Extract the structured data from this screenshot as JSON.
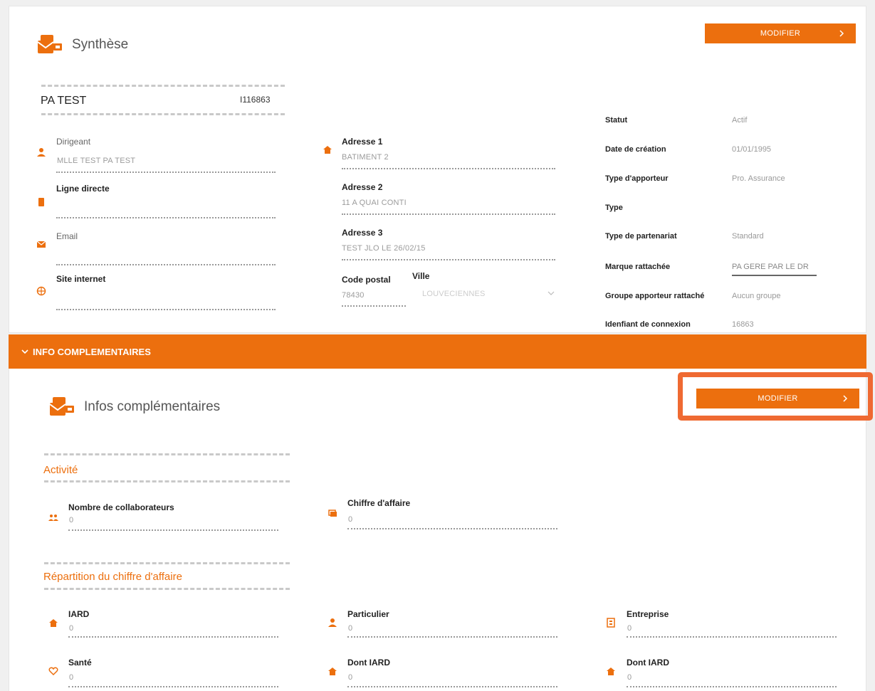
{
  "colors": {
    "accent": "#ec6f0e",
    "highlight": "#ef6a32"
  },
  "synthese": {
    "title": "Synthèse",
    "modify_label": "MODIFIER",
    "company_name": "PA TEST",
    "company_code": "I116863",
    "left_fields": [
      {
        "label": "Dirigeant",
        "value": "MLLE TEST PA TEST",
        "icon": "user-icon"
      },
      {
        "label": "Ligne directe",
        "value": "",
        "icon": "phone-icon"
      },
      {
        "label": "Email",
        "value": "",
        "icon": "mail-icon"
      },
      {
        "label": "Site internet",
        "value": "",
        "icon": "globe-icon"
      }
    ],
    "address_fields": [
      {
        "label": "Adresse 1",
        "value": "BATIMENT 2",
        "icon": "home-icon"
      },
      {
        "label": "Adresse 2",
        "value": "11 A QUAI CONTI"
      },
      {
        "label": "Adresse 3",
        "value": "TEST JLO LE 26/02/15"
      }
    ],
    "postal": {
      "label": "Code postal",
      "value": "78430"
    },
    "city": {
      "label": "Ville",
      "value": "LOUVECIENNES"
    },
    "right_fields": [
      {
        "label": "Statut",
        "value": "Actif"
      },
      {
        "label": "Date de création",
        "value": "01/01/1995"
      },
      {
        "label": "Type d'apporteur",
        "value": "Pro. Assurance"
      },
      {
        "label": "Type",
        "value": ""
      },
      {
        "label": "Type de partenariat",
        "value": "Standard"
      },
      {
        "label": "Marque rattachée",
        "value": "PA GERE PAR LE DR"
      },
      {
        "label": "Groupe apporteur rattaché",
        "value": "Aucun groupe"
      },
      {
        "label": "Idenfiant de connexion",
        "value": "16863"
      }
    ]
  },
  "accordion": {
    "label": "INFO COMPLEMENTAIRES"
  },
  "infos": {
    "title": "Infos complémentaires",
    "modify_label": "MODIFIER",
    "activite": {
      "heading": "Activité",
      "fields": [
        {
          "label": "Nombre de collaborateurs",
          "value": "0",
          "icon": "group-icon"
        },
        {
          "label": "Chiffre d'affaire",
          "value": "0",
          "icon": "money-icon"
        }
      ]
    },
    "repartition": {
      "heading": "Répartition du chiffre d'affaire",
      "fields": [
        {
          "label": "IARD",
          "value": "0",
          "icon": "home-icon"
        },
        {
          "label": "Particulier",
          "value": "0",
          "icon": "user-icon"
        },
        {
          "label": "Entreprise",
          "value": "0",
          "icon": "building-icon"
        },
        {
          "label": "Santé",
          "value": "0",
          "icon": "heart-icon"
        },
        {
          "label": "Dont IARD",
          "value": "0",
          "icon": "home-icon"
        },
        {
          "label": "Dont IARD",
          "value": "0",
          "icon": "home-icon"
        }
      ]
    }
  }
}
